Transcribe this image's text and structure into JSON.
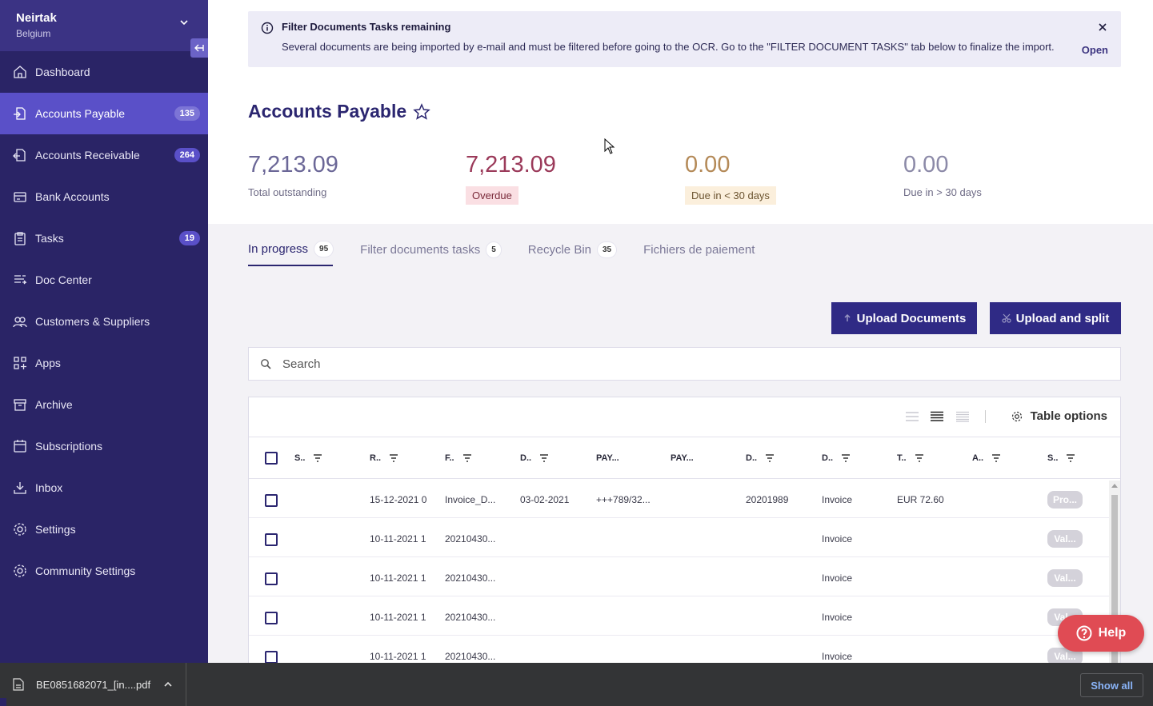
{
  "org": {
    "name": "Neirtak",
    "country": "Belgium"
  },
  "sidebar": {
    "items": [
      {
        "label": "Dashboard",
        "icon": "home-icon",
        "badge": ""
      },
      {
        "label": "Accounts Payable",
        "icon": "payable-icon",
        "badge": "135",
        "active": true
      },
      {
        "label": "Accounts Receivable",
        "icon": "receivable-icon",
        "badge": "264"
      },
      {
        "label": "Bank Accounts",
        "icon": "bank-icon",
        "badge": ""
      },
      {
        "label": "Tasks",
        "icon": "clipboard-icon",
        "badge": "19"
      },
      {
        "label": "Doc Center",
        "icon": "doc-center-icon",
        "badge": ""
      },
      {
        "label": "Customers & Suppliers",
        "icon": "users-icon",
        "badge": ""
      },
      {
        "label": "Apps",
        "icon": "apps-icon",
        "badge": ""
      },
      {
        "label": "Archive",
        "icon": "archive-icon",
        "badge": ""
      },
      {
        "label": "Subscriptions",
        "icon": "subscriptions-icon",
        "badge": ""
      },
      {
        "label": "Inbox",
        "icon": "inbox-icon",
        "badge": ""
      },
      {
        "label": "Settings",
        "icon": "gear-icon",
        "badge": ""
      },
      {
        "label": "Community Settings",
        "icon": "community-gear-icon",
        "badge": ""
      }
    ]
  },
  "banner": {
    "title": "Filter Documents Tasks remaining",
    "text": "Several documents are being imported by e-mail and must be filtered before going to the OCR. Go to the \"FILTER DOCUMENT TASKS\" tab below to finalize the import.",
    "open_label": "Open"
  },
  "page": {
    "title": "Accounts Payable"
  },
  "kpis": [
    {
      "value": "7,213.09",
      "label": "Total outstanding"
    },
    {
      "value": "7,213.09",
      "label": "Overdue"
    },
    {
      "value": "0.00",
      "label": "Due in < 30 days"
    },
    {
      "value": "0.00",
      "label": "Due in > 30 days"
    }
  ],
  "tabs": [
    {
      "label": "In progress",
      "count": "95"
    },
    {
      "label": "Filter documents tasks",
      "count": "5"
    },
    {
      "label": "Recycle Bin",
      "count": "35"
    },
    {
      "label": "Fichiers de paiement",
      "count": ""
    }
  ],
  "actions": {
    "upload": "Upload Documents",
    "upload_split": "Upload and split"
  },
  "search": {
    "placeholder": "Search"
  },
  "table": {
    "options_label": "Table options",
    "columns": [
      "S..",
      "R..",
      "F..",
      "D..",
      "PAY...",
      "PAY...",
      "D..",
      "D..",
      "T..",
      "A..",
      "S.."
    ],
    "rows": [
      {
        "received": "15-12-2021 0",
        "file": "Invoice_D...",
        "date": "03-02-2021",
        "payment_ref": "+++789/32...",
        "doc_number": "20201989",
        "doc_type": "Invoice",
        "total": "EUR 72.60",
        "status": "Pro..."
      },
      {
        "received": "10-11-2021 1",
        "file": "20210430...",
        "date": "",
        "payment_ref": "",
        "doc_number": "",
        "doc_type": "Invoice",
        "total": "",
        "status": "Val..."
      },
      {
        "received": "10-11-2021 1",
        "file": "20210430...",
        "date": "",
        "payment_ref": "",
        "doc_number": "",
        "doc_type": "Invoice",
        "total": "",
        "status": "Val..."
      },
      {
        "received": "10-11-2021 1",
        "file": "20210430...",
        "date": "",
        "payment_ref": "",
        "doc_number": "",
        "doc_type": "Invoice",
        "total": "",
        "status": "Val..."
      },
      {
        "received": "10-11-2021 1",
        "file": "20210430...",
        "date": "",
        "payment_ref": "",
        "doc_number": "",
        "doc_type": "Invoice",
        "total": "",
        "status": "Val..."
      }
    ]
  },
  "help": {
    "label": "Help"
  },
  "download_bar": {
    "filename": "BE0851682071_[in....pdf",
    "show_all": "Show all"
  },
  "colors": {
    "sidebar": "#2a2466",
    "accent": "#5a50c8",
    "button": "#2f2a85",
    "help": "#e04b54"
  }
}
